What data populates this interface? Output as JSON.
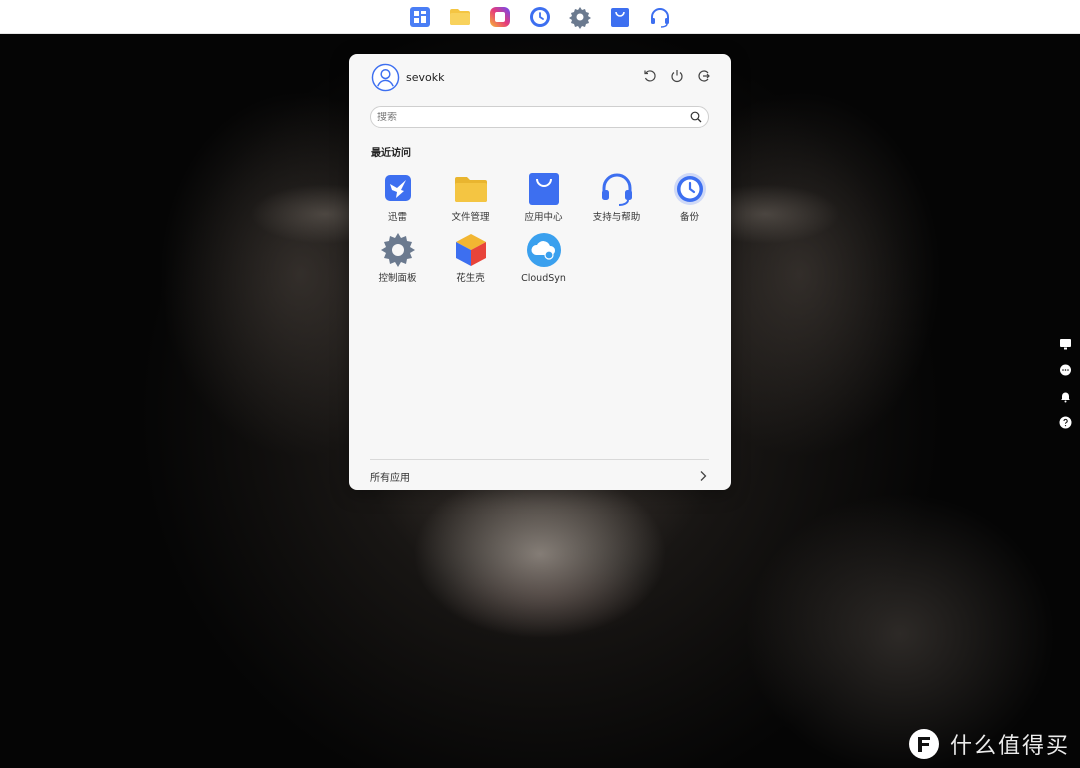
{
  "dock": {
    "apps": [
      {
        "name": "mosaic-app-icon"
      },
      {
        "name": "folder-icon"
      },
      {
        "name": "instagram-style-icon"
      },
      {
        "name": "backup-clock-icon"
      },
      {
        "name": "gear-icon"
      },
      {
        "name": "shopping-bag-icon"
      },
      {
        "name": "headset-icon"
      }
    ]
  },
  "start_menu": {
    "username": "sevokk",
    "search_placeholder": "搜索",
    "recent_title": "最近访问",
    "apps": [
      {
        "label": "迅雷",
        "icon": "thunder-bird-icon"
      },
      {
        "label": "文件管理",
        "icon": "folder-icon"
      },
      {
        "label": "应用中心",
        "icon": "shopping-bag-icon"
      },
      {
        "label": "支持与帮助",
        "icon": "headset-icon"
      },
      {
        "label": "备份",
        "icon": "backup-clock-icon"
      },
      {
        "label": "控制面板",
        "icon": "gear-icon"
      },
      {
        "label": "花生壳",
        "icon": "cube-icon"
      },
      {
        "label": "CloudSyn",
        "icon": "cloud-sync-icon"
      }
    ],
    "all_apps_label": "所有应用"
  },
  "watermark": {
    "text": "什么值得买"
  },
  "colors": {
    "accent_blue": "#3d6ff0",
    "folder_yellow": "#f4c542",
    "panel_bg": "#f7f7f7"
  }
}
